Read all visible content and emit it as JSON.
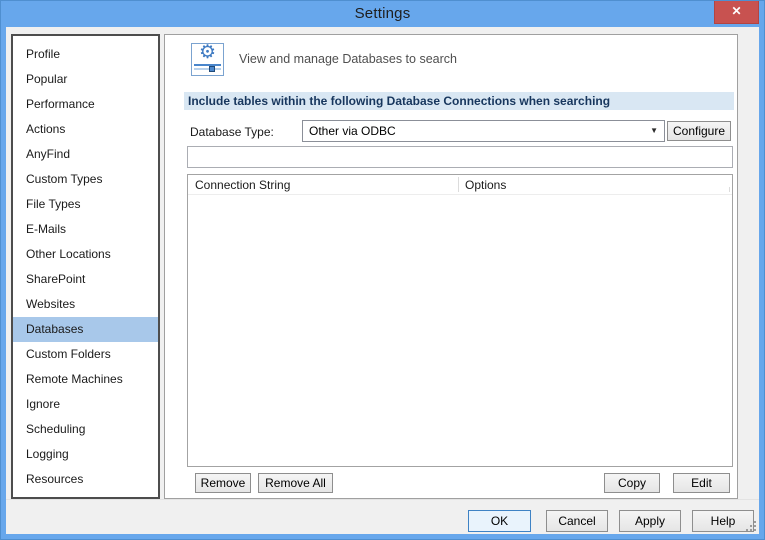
{
  "window": {
    "title": "Settings"
  },
  "icons": {
    "close": "✕",
    "settings_gear": "⚙",
    "dropdown_arrow": "▼"
  },
  "sidebar": {
    "items": [
      "Profile",
      "Popular",
      "Performance",
      "Actions",
      "AnyFind",
      "Custom Types",
      "File Types",
      "E-Mails",
      "Other Locations",
      "SharePoint",
      "Websites",
      "Databases",
      "Custom Folders",
      "Remote Machines",
      "Ignore",
      "Scheduling",
      "Logging",
      "Resources"
    ],
    "selected": "Databases"
  },
  "main": {
    "caption": "View and manage Databases to search",
    "section_header": "Include tables within the following Database Connections when searching",
    "database_type_label": "Database Type:",
    "database_type_value": "Other via ODBC",
    "configure_label": "Configure",
    "connection_value": "",
    "table": {
      "columns": {
        "0": "Connection String",
        "1": "Options"
      },
      "rows": []
    },
    "remove_label": "Remove",
    "remove_all_label": "Remove All",
    "copy_label": "Copy",
    "edit_label": "Edit"
  },
  "footer": {
    "ok": "OK",
    "cancel": "Cancel",
    "apply": "Apply",
    "help": "Help"
  },
  "colors": {
    "titlebar_blue": "#67a7ec",
    "close_red": "#c85250",
    "section_bar_bg": "#d9e7f3",
    "section_text": "#17365d",
    "selected_item_bg": "#a8c8ea"
  }
}
